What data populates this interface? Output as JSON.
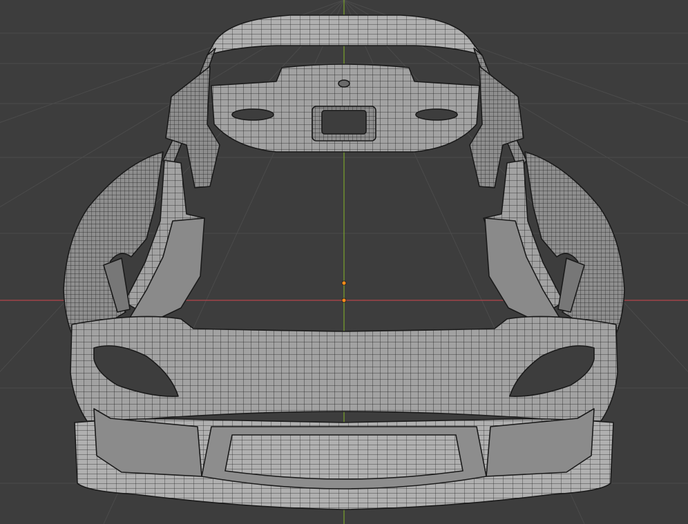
{
  "viewport": {
    "background": "#3d3d3d",
    "grid_color": "#4b4b4b",
    "x_axis_color": "#b5454d",
    "y_axis_color": "#7aa42b",
    "origin_color": "#ff8c1a"
  },
  "model": {
    "shading": "solid-wireframe",
    "fill": "#9a9a9a",
    "wire": "#222222",
    "icon": "car-body-mesh-icon"
  }
}
